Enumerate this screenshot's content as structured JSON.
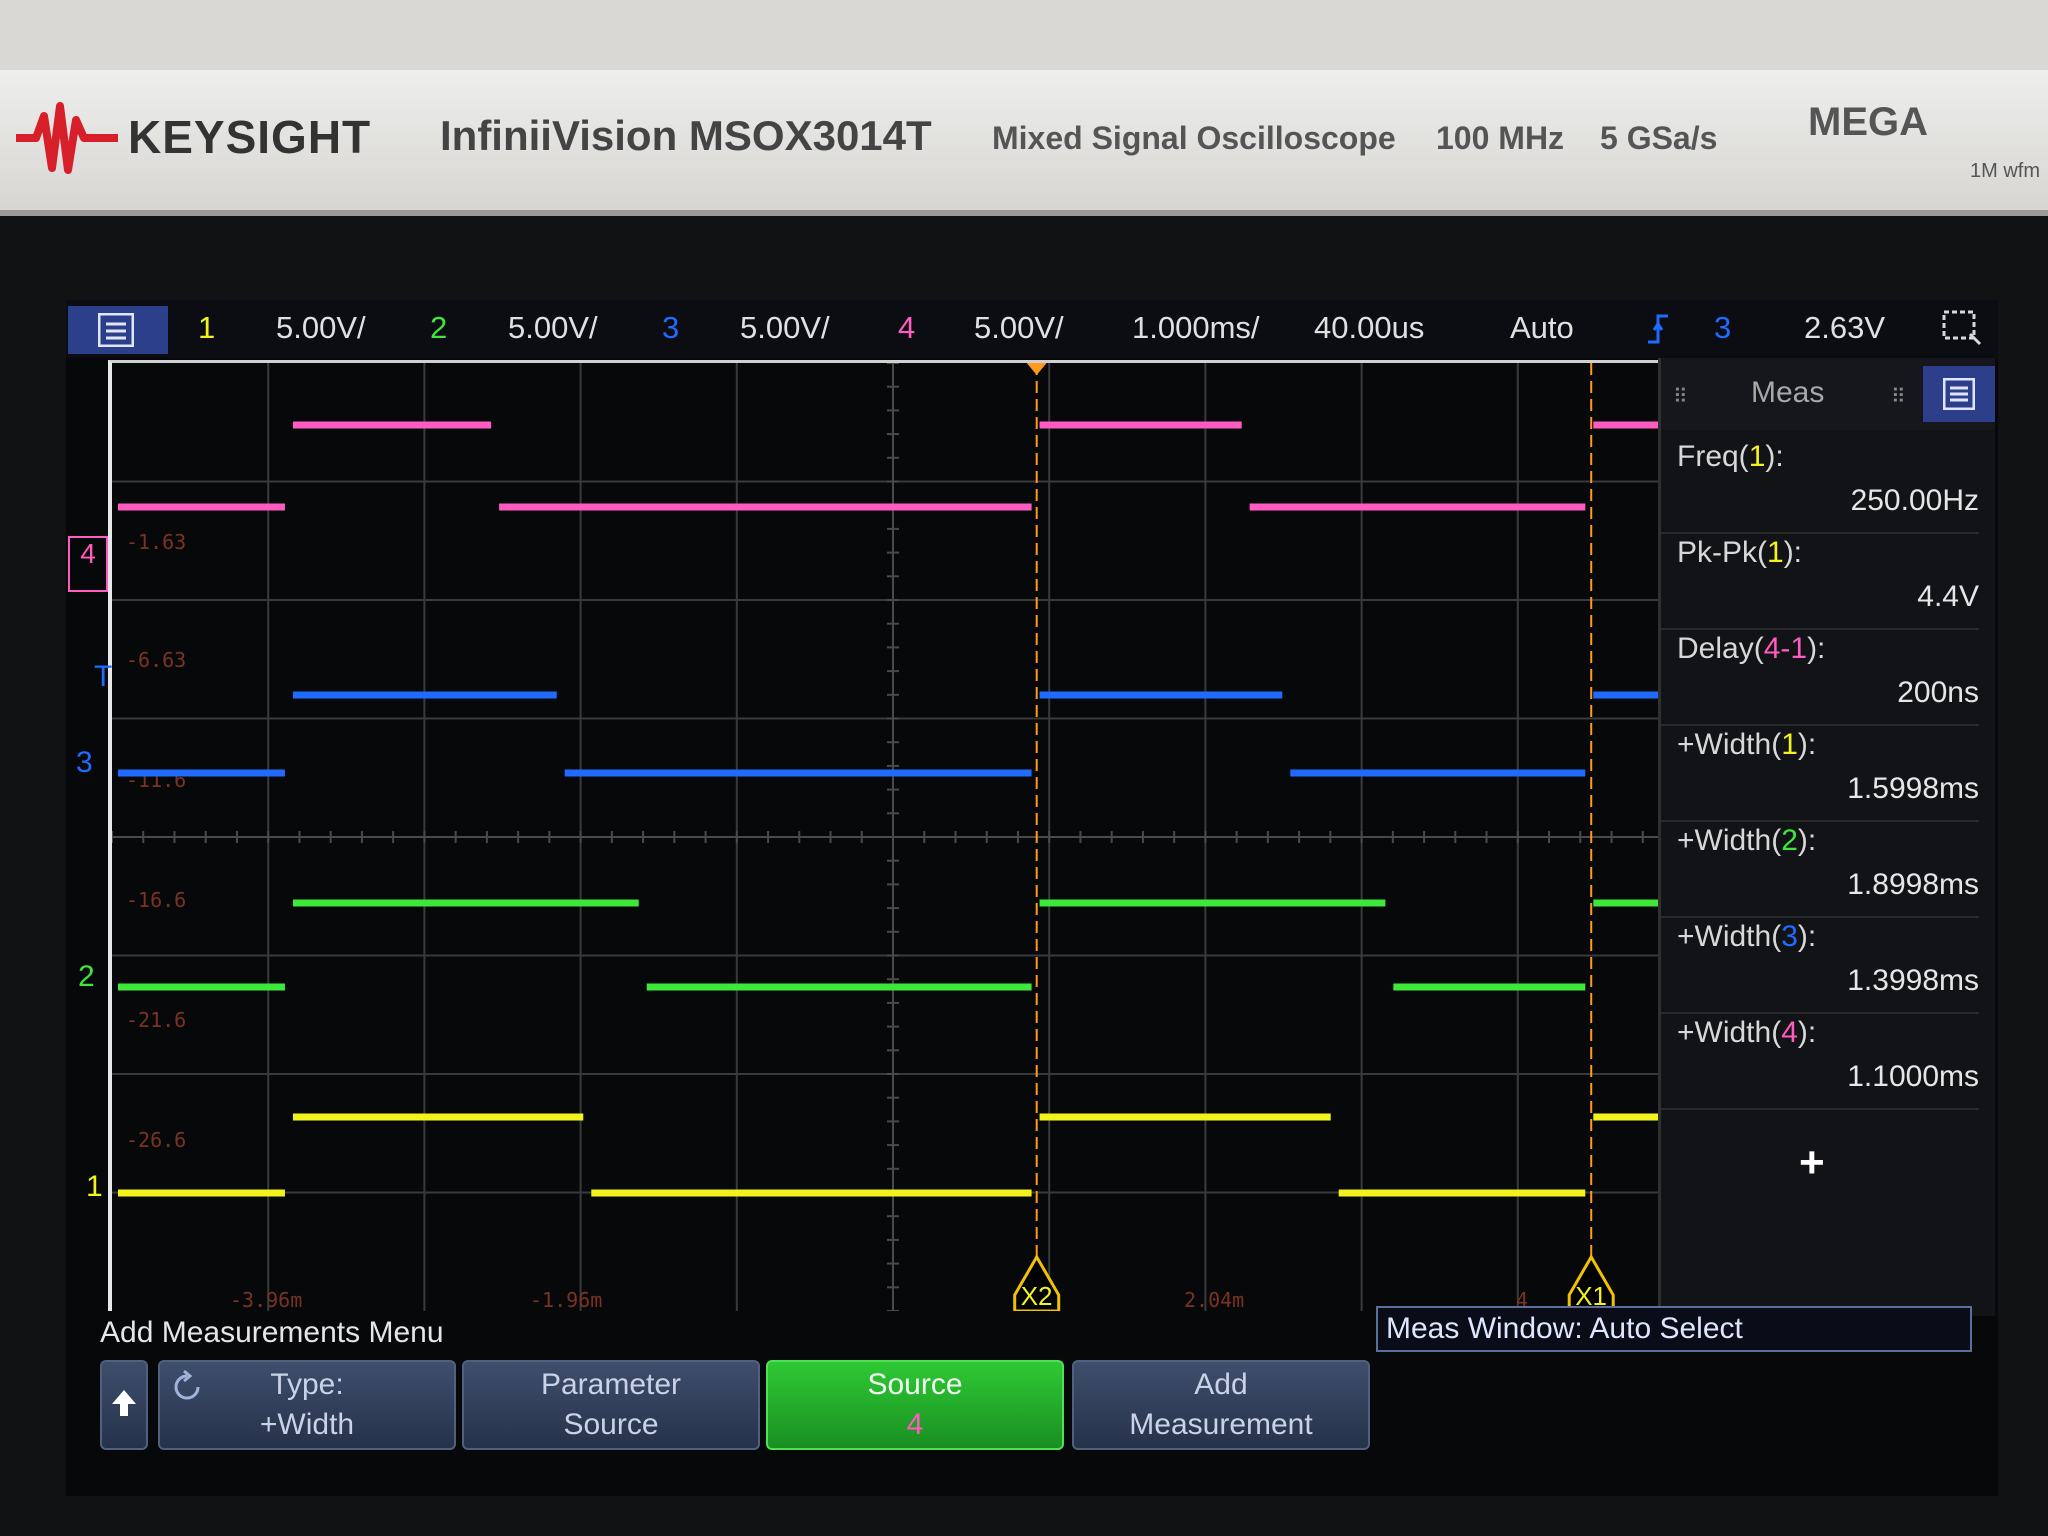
{
  "instrument": {
    "brand": "KEYSIGHT",
    "model": "InfiniiVision MSOX3014T",
    "description": "Mixed Signal Oscilloscope",
    "bandwidth": "100 MHz",
    "sample_rate": "5 GSa/s",
    "megazoom": "MEGA",
    "megazoom_sub": "1M wfm"
  },
  "status_bar": {
    "ch1_num": "1",
    "ch1_scale": "5.00V/",
    "ch2_num": "2",
    "ch2_scale": "5.00V/",
    "ch3_num": "3",
    "ch3_scale": "5.00V/",
    "ch4_num": "4",
    "ch4_scale": "5.00V/",
    "timebase": "1.000ms/",
    "delay": "40.00us",
    "trigger_mode": "Auto",
    "trigger_source": "3",
    "trigger_level": "2.63V"
  },
  "colors": {
    "ch1": "#f2f21c",
    "ch2": "#3ee83a",
    "ch3": "#1f6bff",
    "ch4": "#ff5bc0",
    "accent_menu": "#2d3f8a",
    "source_key": "#22b02a"
  },
  "graticule_labels": {
    "offsets": [
      "-1.63",
      "-6.63",
      "-11.6",
      "-16.6",
      "-21.6",
      "-26.6"
    ],
    "time": [
      "-3.96m",
      "-1.96m",
      "",
      "2.04m",
      "4"
    ],
    "cursor_x1": "X1",
    "cursor_x2": "X2"
  },
  "channel_markers": {
    "ch1": "1",
    "ch2": "2",
    "ch3": "3",
    "ch4": "4",
    "trigger": "T"
  },
  "meas_panel": {
    "title": "Meas",
    "items": [
      {
        "name": "Freq",
        "src": "1",
        "value": "250.00Hz"
      },
      {
        "name": "Pk-Pk",
        "src": "1",
        "value": "4.4V"
      },
      {
        "name": "Delay",
        "src": "4-1",
        "value": "200ns"
      },
      {
        "name": "+Width",
        "src": "1",
        "value": "1.5998ms"
      },
      {
        "name": "+Width",
        "src": "2",
        "value": "1.8998ms"
      },
      {
        "name": "+Width",
        "src": "3",
        "value": "1.3998ms"
      },
      {
        "name": "+Width",
        "src": "4",
        "value": "1.1000ms"
      }
    ],
    "add_symbol": "+"
  },
  "softkeys": {
    "menu_title": "Add Measurements Menu",
    "meas_window": "Meas Window: Auto Select",
    "type_l1": "Type:",
    "type_l2": "+Width",
    "param_l1": "Parameter",
    "param_l2": "Source",
    "source_l1": "Source",
    "source_l2": "4",
    "add_l1": "Add",
    "add_l2": "Measurement"
  },
  "waveforms": {
    "ch4": {
      "low": 0,
      "high": 1,
      "edges": [
        0.112,
        0.244,
        0.59,
        0.7245,
        0.9445
      ]
    },
    "ch3": {
      "low": 0,
      "high": 1,
      "edges": [
        0.112,
        0.286,
        0.59,
        0.7505,
        0.9445
      ]
    },
    "ch2": {
      "low": 0,
      "high": 1,
      "edges": [
        0.112,
        0.3385,
        0.59,
        0.8165,
        0.9445
      ]
    },
    "ch1": {
      "low": 0,
      "high": 1,
      "edges": [
        0.112,
        0.303,
        0.59,
        0.7815,
        0.9445
      ]
    }
  }
}
